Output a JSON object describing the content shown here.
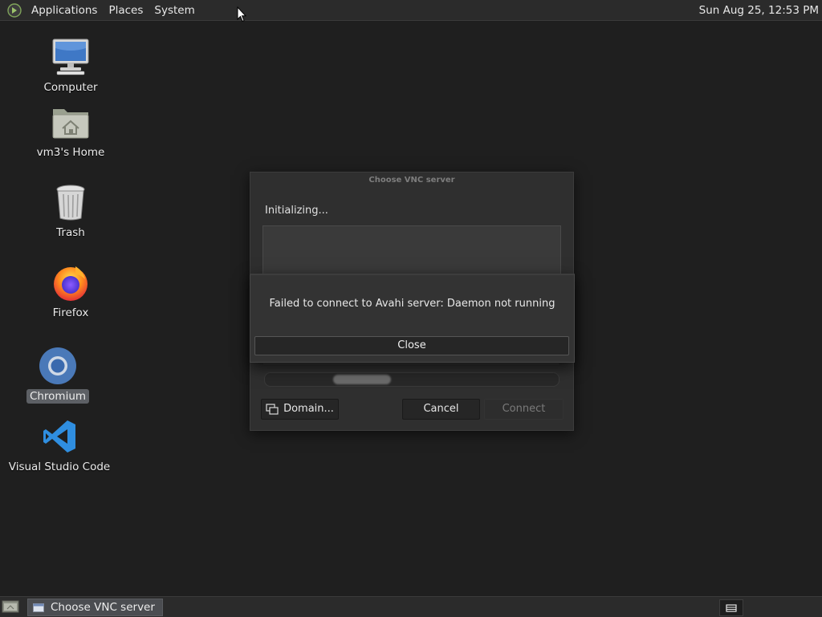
{
  "top_panel": {
    "menus": [
      "Applications",
      "Places",
      "System"
    ],
    "clock": "Sun Aug 25, 12:53 PM"
  },
  "desktop": {
    "icons": [
      {
        "label": "Computer",
        "icon": "computer-icon"
      },
      {
        "label": "vm3's Home",
        "icon": "home-folder-icon"
      },
      {
        "label": "Trash",
        "icon": "trash-icon"
      },
      {
        "label": "Firefox",
        "icon": "firefox-icon"
      },
      {
        "label": "Chromium",
        "icon": "chromium-icon",
        "selected": true
      },
      {
        "label": "Visual Studio Code",
        "icon": "vscode-icon"
      }
    ]
  },
  "vnc_dialog": {
    "title": "Choose VNC server",
    "status": "Initializing...",
    "buttons": {
      "domain": "Domain...",
      "cancel": "Cancel",
      "connect": "Connect"
    }
  },
  "error_dialog": {
    "message": "Failed to connect to Avahi server: Daemon not running",
    "close": "Close"
  },
  "taskbar": {
    "window_label": "Choose VNC server"
  },
  "colors": {
    "desktop_bg": "#1f1f1f",
    "panel_bg": "#2b2b2b",
    "dialog_bg": "#2f2f2f",
    "selection": "#5d6065"
  }
}
